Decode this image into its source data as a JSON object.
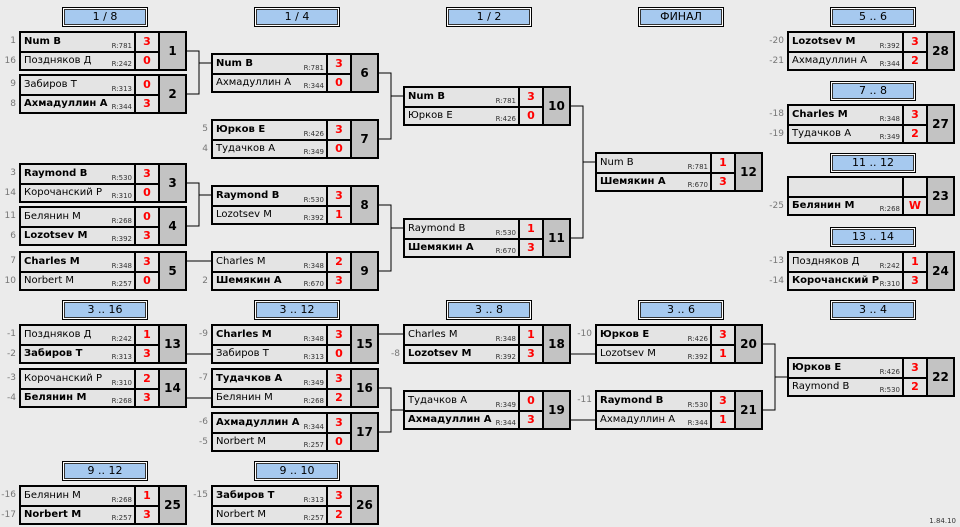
{
  "headers": [
    {
      "id": "h18",
      "label": "1 / 8"
    },
    {
      "id": "h14",
      "label": "1 / 4"
    },
    {
      "id": "h12",
      "label": "1 / 2"
    },
    {
      "id": "hf",
      "label": "ФИНАЛ"
    },
    {
      "id": "h56",
      "label": "5 .. 6"
    },
    {
      "id": "h78",
      "label": "7 .. 8"
    },
    {
      "id": "h1112",
      "label": "11 .. 12"
    },
    {
      "id": "h1314",
      "label": "13 .. 14"
    },
    {
      "id": "h316",
      "label": "3 .. 16"
    },
    {
      "id": "h312",
      "label": "3 .. 12"
    },
    {
      "id": "h38",
      "label": "3 .. 8"
    },
    {
      "id": "h36",
      "label": "3 .. 6"
    },
    {
      "id": "h34",
      "label": "3 .. 4"
    },
    {
      "id": "h912",
      "label": "9 .. 12"
    },
    {
      "id": "h910",
      "label": "9 .. 10"
    }
  ],
  "matches": [
    {
      "num": "1",
      "players": [
        {
          "seed": "1",
          "name": "Num B",
          "rating": "R:781",
          "score": "3",
          "win": true
        },
        {
          "seed": "16",
          "name": "Поздняков Д",
          "rating": "R:242",
          "score": "0"
        }
      ]
    },
    {
      "num": "2",
      "players": [
        {
          "seed": "9",
          "name": "Забиров Т",
          "rating": "R:313",
          "score": "0"
        },
        {
          "seed": "8",
          "name": "Ахмадуллин А",
          "rating": "R:344",
          "score": "3",
          "win": true
        }
      ]
    },
    {
      "num": "3",
      "players": [
        {
          "seed": "3",
          "name": "Raymond B",
          "rating": "R:530",
          "score": "3",
          "win": true
        },
        {
          "seed": "14",
          "name": "Корочанский Р",
          "rating": "R:310",
          "score": "0"
        }
      ]
    },
    {
      "num": "4",
      "players": [
        {
          "seed": "11",
          "name": "Белянин М",
          "rating": "R:268",
          "score": "0"
        },
        {
          "seed": "6",
          "name": "Lozotsev M",
          "rating": "R:392",
          "score": "3",
          "win": true
        }
      ]
    },
    {
      "num": "5",
      "players": [
        {
          "seed": "7",
          "name": "Charles M",
          "rating": "R:348",
          "score": "3",
          "win": true
        },
        {
          "seed": "10",
          "name": "Norbert M",
          "rating": "R:257",
          "score": "0"
        }
      ]
    },
    {
      "num": "6",
      "players": [
        {
          "seed": "",
          "name": "Num B",
          "rating": "R:781",
          "score": "3",
          "win": true
        },
        {
          "seed": "",
          "name": "Ахмадуллин А",
          "rating": "R:344",
          "score": "0"
        }
      ]
    },
    {
      "num": "7",
      "players": [
        {
          "seed": "5",
          "name": "Юрков Е",
          "rating": "R:426",
          "score": "3",
          "win": true
        },
        {
          "seed": "4",
          "name": "Тудачков А",
          "rating": "R:349",
          "score": "0"
        }
      ]
    },
    {
      "num": "8",
      "players": [
        {
          "seed": "",
          "name": "Raymond B",
          "rating": "R:530",
          "score": "3",
          "win": true
        },
        {
          "seed": "",
          "name": "Lozotsev M",
          "rating": "R:392",
          "score": "1"
        }
      ]
    },
    {
      "num": "9",
      "players": [
        {
          "seed": "",
          "name": "Charles M",
          "rating": "R:348",
          "score": "2"
        },
        {
          "seed": "2",
          "name": "Шемякин А",
          "rating": "R:670",
          "score": "3",
          "win": true
        }
      ]
    },
    {
      "num": "10",
      "players": [
        {
          "seed": "",
          "name": "Num B",
          "rating": "R:781",
          "score": "3",
          "win": true
        },
        {
          "seed": "",
          "name": "Юрков Е",
          "rating": "R:426",
          "score": "0"
        }
      ]
    },
    {
      "num": "11",
      "players": [
        {
          "seed": "",
          "name": "Raymond B",
          "rating": "R:530",
          "score": "1"
        },
        {
          "seed": "",
          "name": "Шемякин А",
          "rating": "R:670",
          "score": "3",
          "win": true
        }
      ]
    },
    {
      "num": "12",
      "players": [
        {
          "seed": "",
          "name": "Num B",
          "rating": "R:781",
          "score": "1"
        },
        {
          "seed": "",
          "name": "Шемякин А",
          "rating": "R:670",
          "score": "3",
          "win": true
        }
      ]
    },
    {
      "num": "28",
      "players": [
        {
          "seed": "-20",
          "name": "Lozotsev M",
          "rating": "R:392",
          "score": "3",
          "win": true
        },
        {
          "seed": "-21",
          "name": "Ахмадуллин А",
          "rating": "R:344",
          "score": "2"
        }
      ]
    },
    {
      "num": "27",
      "players": [
        {
          "seed": "-18",
          "name": "Charles M",
          "rating": "R:348",
          "score": "3",
          "win": true
        },
        {
          "seed": "-19",
          "name": "Тудачков А",
          "rating": "R:349",
          "score": "2"
        }
      ]
    },
    {
      "num": "23",
      "players": [
        {
          "seed": "",
          "name": "",
          "rating": "",
          "score": ""
        },
        {
          "seed": "-25",
          "name": "Белянин М",
          "rating": "R:268",
          "score": "W",
          "win": true
        }
      ]
    },
    {
      "num": "24",
      "players": [
        {
          "seed": "-13",
          "name": "Поздняков Д",
          "rating": "R:242",
          "score": "1"
        },
        {
          "seed": "-14",
          "name": "Корочанский Р",
          "rating": "R:310",
          "score": "3",
          "win": true
        }
      ]
    },
    {
      "num": "13",
      "players": [
        {
          "seed": "-1",
          "name": "Поздняков Д",
          "rating": "R:242",
          "score": "1"
        },
        {
          "seed": "-2",
          "name": "Забиров Т",
          "rating": "R:313",
          "score": "3",
          "win": true
        }
      ]
    },
    {
      "num": "14",
      "players": [
        {
          "seed": "-3",
          "name": "Корочанский Р",
          "rating": "R:310",
          "score": "2"
        },
        {
          "seed": "-4",
          "name": "Белянин М",
          "rating": "R:268",
          "score": "3",
          "win": true
        }
      ]
    },
    {
      "num": "15",
      "players": [
        {
          "seed": "-9",
          "name": "Charles M",
          "rating": "R:348",
          "score": "3",
          "win": true
        },
        {
          "seed": "",
          "name": "Забиров Т",
          "rating": "R:313",
          "score": "0"
        }
      ]
    },
    {
      "num": "16",
      "players": [
        {
          "seed": "-7",
          "name": "Тудачков А",
          "rating": "R:349",
          "score": "3",
          "win": true
        },
        {
          "seed": "",
          "name": "Белянин М",
          "rating": "R:268",
          "score": "2"
        }
      ]
    },
    {
      "num": "17",
      "players": [
        {
          "seed": "-6",
          "name": "Ахмадуллин А",
          "rating": "R:344",
          "score": "3",
          "win": true
        },
        {
          "seed": "-5",
          "name": "Norbert M",
          "rating": "R:257",
          "score": "0"
        }
      ]
    },
    {
      "num": "18",
      "players": [
        {
          "seed": "",
          "name": "Charles M",
          "rating": "R:348",
          "score": "1"
        },
        {
          "seed": "-8",
          "name": "Lozotsev M",
          "rating": "R:392",
          "score": "3",
          "win": true
        }
      ]
    },
    {
      "num": "19",
      "players": [
        {
          "seed": "",
          "name": "Тудачков А",
          "rating": "R:349",
          "score": "0"
        },
        {
          "seed": "",
          "name": "Ахмадуллин А",
          "rating": "R:344",
          "score": "3",
          "win": true
        }
      ]
    },
    {
      "num": "20",
      "players": [
        {
          "seed": "-10",
          "name": "Юрков Е",
          "rating": "R:426",
          "score": "3",
          "win": true
        },
        {
          "seed": "",
          "name": "Lozotsev M",
          "rating": "R:392",
          "score": "1"
        }
      ]
    },
    {
      "num": "21",
      "players": [
        {
          "seed": "-11",
          "name": "Raymond B",
          "rating": "R:530",
          "score": "3",
          "win": true
        },
        {
          "seed": "",
          "name": "Ахмадуллин А",
          "rating": "R:344",
          "score": "1"
        }
      ]
    },
    {
      "num": "22",
      "players": [
        {
          "seed": "",
          "name": "Юрков Е",
          "rating": "R:426",
          "score": "3",
          "win": true
        },
        {
          "seed": "",
          "name": "Raymond B",
          "rating": "R:530",
          "score": "2"
        }
      ]
    },
    {
      "num": "25",
      "players": [
        {
          "seed": "-16",
          "name": "Белянин М",
          "rating": "R:268",
          "score": "1"
        },
        {
          "seed": "-17",
          "name": "Norbert M",
          "rating": "R:257",
          "score": "3",
          "win": true
        }
      ]
    },
    {
      "num": "26",
      "players": [
        {
          "seed": "-15",
          "name": "Забиров Т",
          "rating": "R:313",
          "score": "3",
          "win": true
        },
        {
          "seed": "",
          "name": "Norbert M",
          "rating": "R:257",
          "score": "2"
        }
      ]
    }
  ],
  "version": "1.84.10",
  "colors": {
    "background": "#ebebeb",
    "header": "#a6c9ef",
    "score": "#ff0000",
    "match_number": "#c3c3c3"
  }
}
